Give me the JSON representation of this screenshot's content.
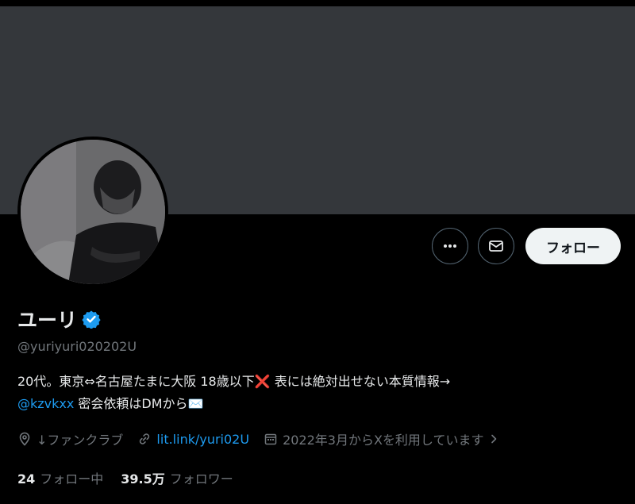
{
  "profile": {
    "display_name": "ユーリ",
    "handle": "@yuriyuri020202U",
    "bio_line1": "20代。東京⇔名古屋たまに大阪 18歳以下❌ 表には絶対出せない本質情報→",
    "bio_mention": "@kzvkxx",
    "bio_line2": " 密会依頼はDMから✉️",
    "location": "↓ファンクラブ",
    "website": "lit.link/yuri02U",
    "joined": "2022年3月からXを利用しています",
    "following_count": "24",
    "following_label": "フォロー中",
    "followers_count": "39.5万",
    "followers_label": "フォロワー"
  },
  "actions": {
    "more_icon": "more-horizontal-icon",
    "message_icon": "envelope-icon",
    "follow_label": "フォロー"
  },
  "colors": {
    "background": "#000000",
    "banner": "#34373b",
    "link": "#1d9bf0",
    "verified": "#1d9bf0",
    "muted": "#71767b",
    "follow_button_bg": "#eff3f4"
  }
}
